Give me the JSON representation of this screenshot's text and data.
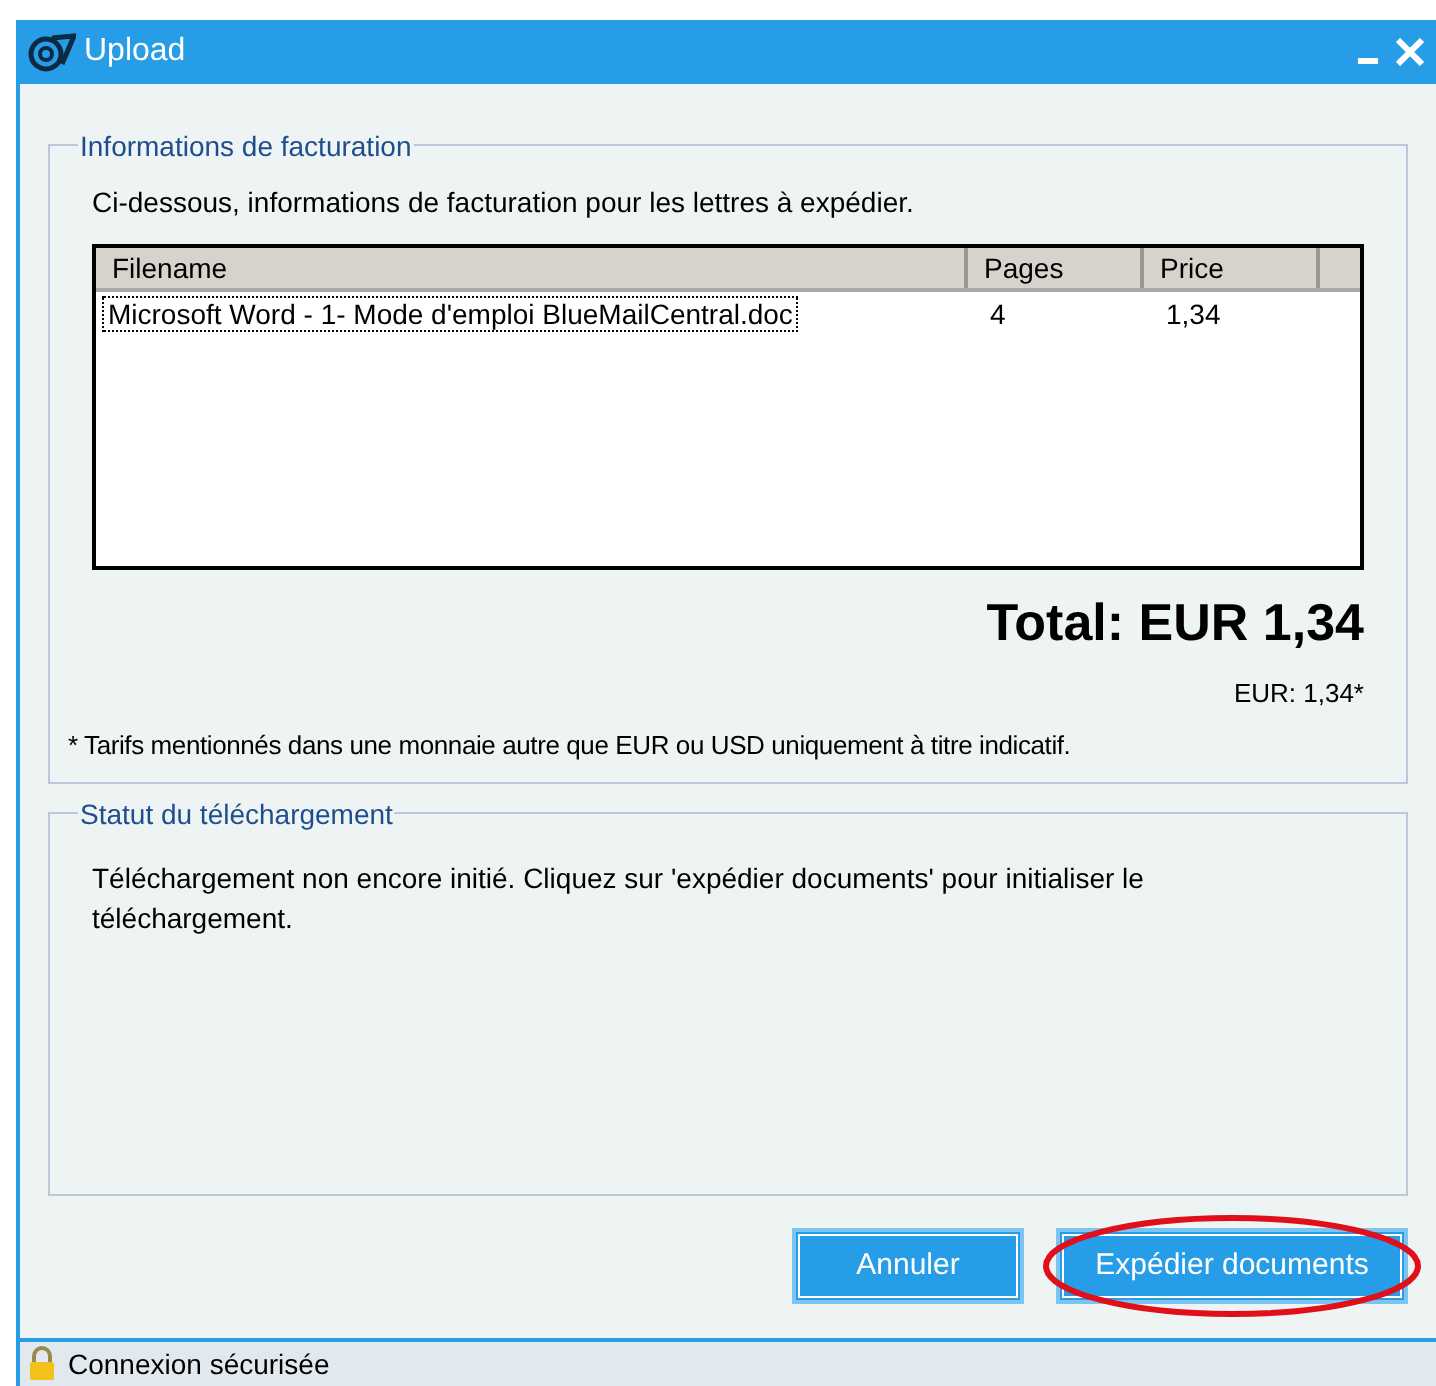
{
  "window": {
    "title": "Upload"
  },
  "billing": {
    "legend": "Informations de facturation",
    "intro": "Ci-dessous, informations de facturation pour les lettres à expédier.",
    "table": {
      "columns": [
        "Filename",
        "Pages",
        "Price"
      ],
      "rows": [
        {
          "cells": [
            "Microsoft Word - 1- Mode d'emploi BlueMailCentral.doc",
            "4",
            "1,34"
          ],
          "focused": true
        }
      ]
    },
    "total": "Total: EUR 1,34",
    "subtotal": "EUR: 1,34*",
    "note": "* Tarifs mentionnés dans une monnaie autre que EUR ou USD uniquement à titre indicatif."
  },
  "status": {
    "legend": "Statut du téléchargement",
    "message": "Téléchargement non encore initié. Cliquez sur 'expédier documents' pour initialiser le téléchargement."
  },
  "buttons": [
    {
      "label": "Annuler",
      "highlighted": false
    },
    {
      "label": "Expédier documents",
      "highlighted": true
    }
  ],
  "status_bar": {
    "text": "Connexion sécurisée"
  }
}
